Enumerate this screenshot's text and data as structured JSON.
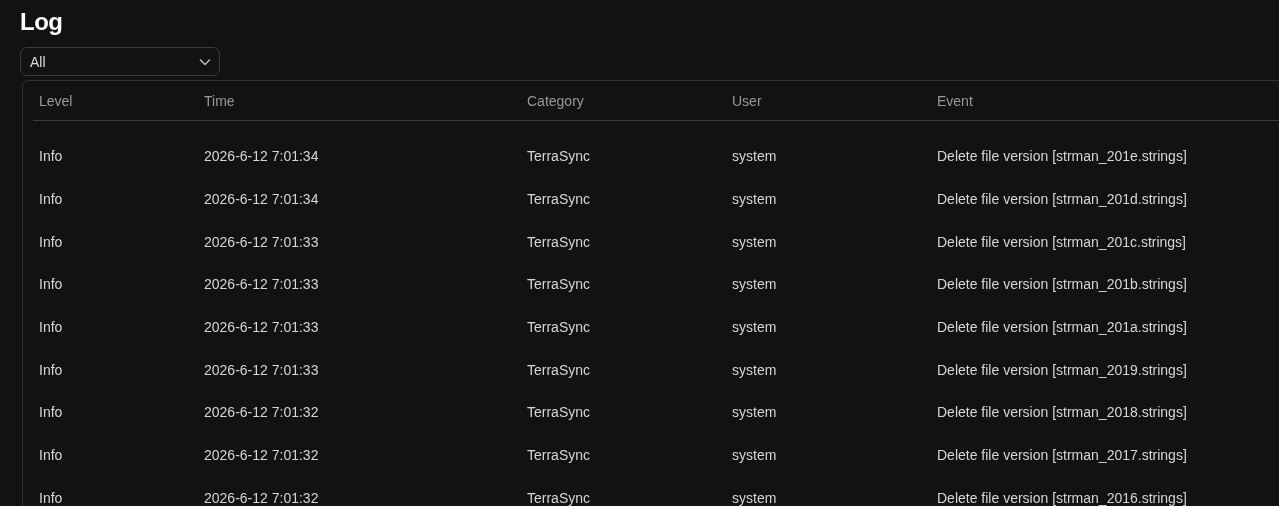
{
  "title": "Log",
  "filter": {
    "value": "All"
  },
  "table": {
    "columns": [
      "Level",
      "Time",
      "Category",
      "User",
      "Event"
    ],
    "rows": [
      [
        "Info",
        "2026-6-12 7:01:34",
        "TerraSync",
        "system",
        "Delete file version [strman_201e.strings]"
      ],
      [
        "Info",
        "2026-6-12 7:01:34",
        "TerraSync",
        "system",
        "Delete file version [strman_201d.strings]"
      ],
      [
        "Info",
        "2026-6-12 7:01:33",
        "TerraSync",
        "system",
        "Delete file version [strman_201c.strings]"
      ],
      [
        "Info",
        "2026-6-12 7:01:33",
        "TerraSync",
        "system",
        "Delete file version [strman_201b.strings]"
      ],
      [
        "Info",
        "2026-6-12 7:01:33",
        "TerraSync",
        "system",
        "Delete file version [strman_201a.strings]"
      ],
      [
        "Info",
        "2026-6-12 7:01:33",
        "TerraSync",
        "system",
        "Delete file version [strman_2019.strings]"
      ],
      [
        "Info",
        "2026-6-12 7:01:32",
        "TerraSync",
        "system",
        "Delete file version [strman_2018.strings]"
      ],
      [
        "Info",
        "2026-6-12 7:01:32",
        "TerraSync",
        "system",
        "Delete file version [strman_2017.strings]"
      ],
      [
        "Info",
        "2026-6-12 7:01:32",
        "TerraSync",
        "system",
        "Delete file version [strman_2016.strings]"
      ]
    ]
  }
}
